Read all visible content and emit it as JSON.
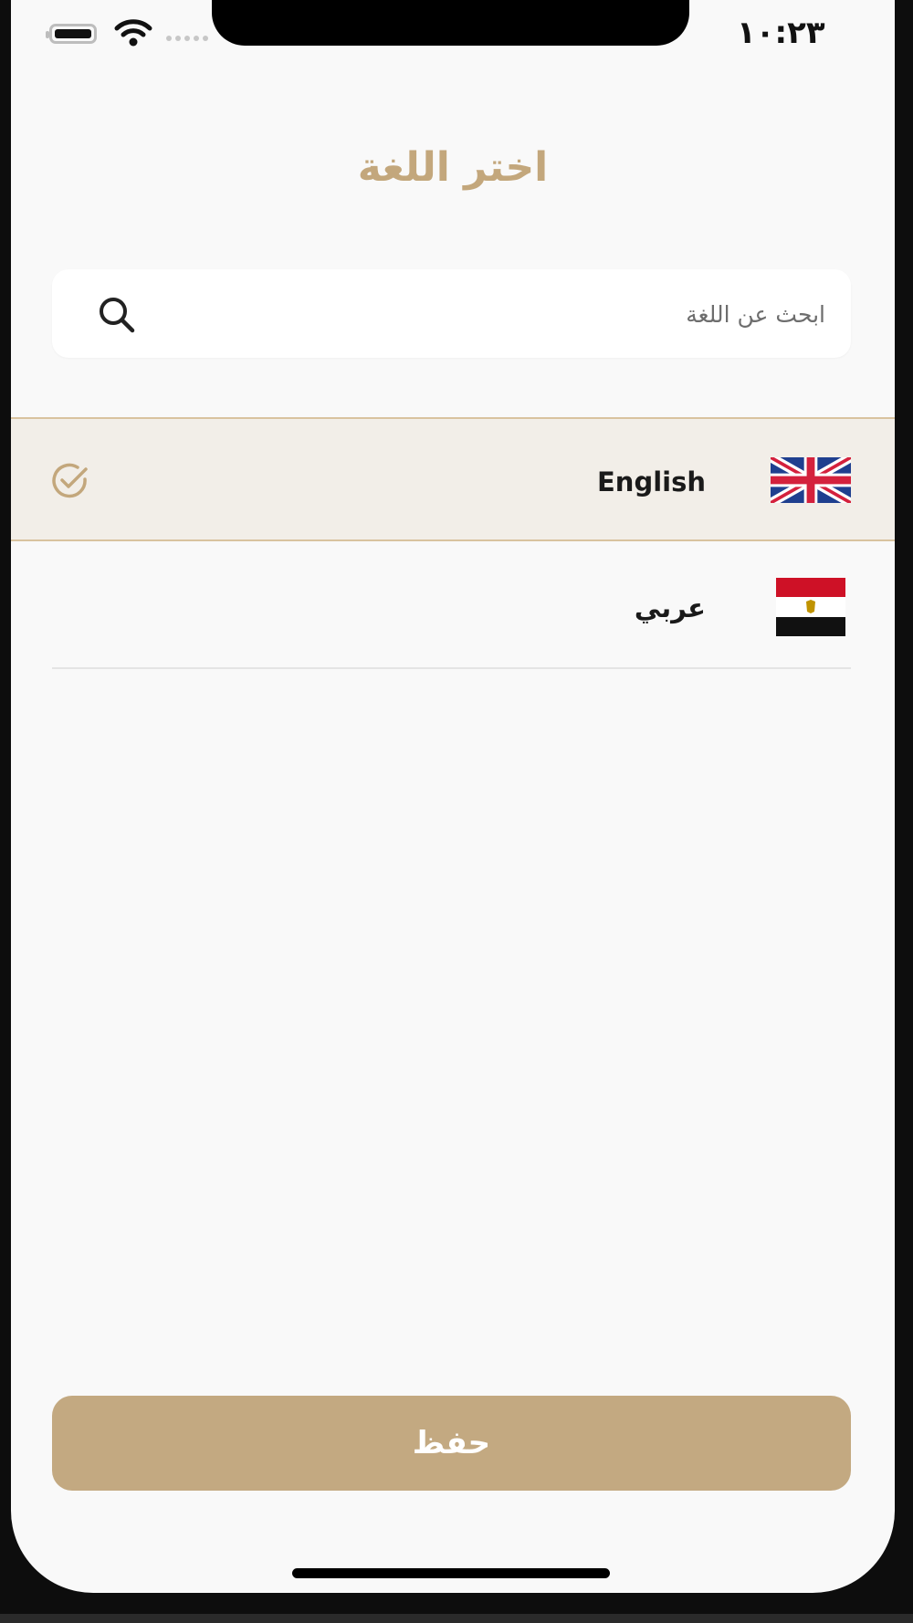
{
  "status_bar": {
    "time": "١٠:٢٣",
    "battery_icon": "battery-icon",
    "wifi_icon": "wifi-icon",
    "signal_icon": "signal-icon"
  },
  "page": {
    "title": "اختر اللغة"
  },
  "search": {
    "placeholder": "ابحث عن اللغة",
    "value": "",
    "icon": "search-icon"
  },
  "languages": [
    {
      "label": "English",
      "flag": "uk-flag-icon",
      "selected": true
    },
    {
      "label": "عربي",
      "flag": "egypt-flag-icon",
      "selected": false
    }
  ],
  "actions": {
    "save_label": "حفظ"
  },
  "colors": {
    "accent": "#c3a77c",
    "selected_row_bg": "#f2eee8",
    "selected_row_border": "#d9c39f",
    "button_bg": "#c3a981",
    "background": "#f9f9f9"
  }
}
